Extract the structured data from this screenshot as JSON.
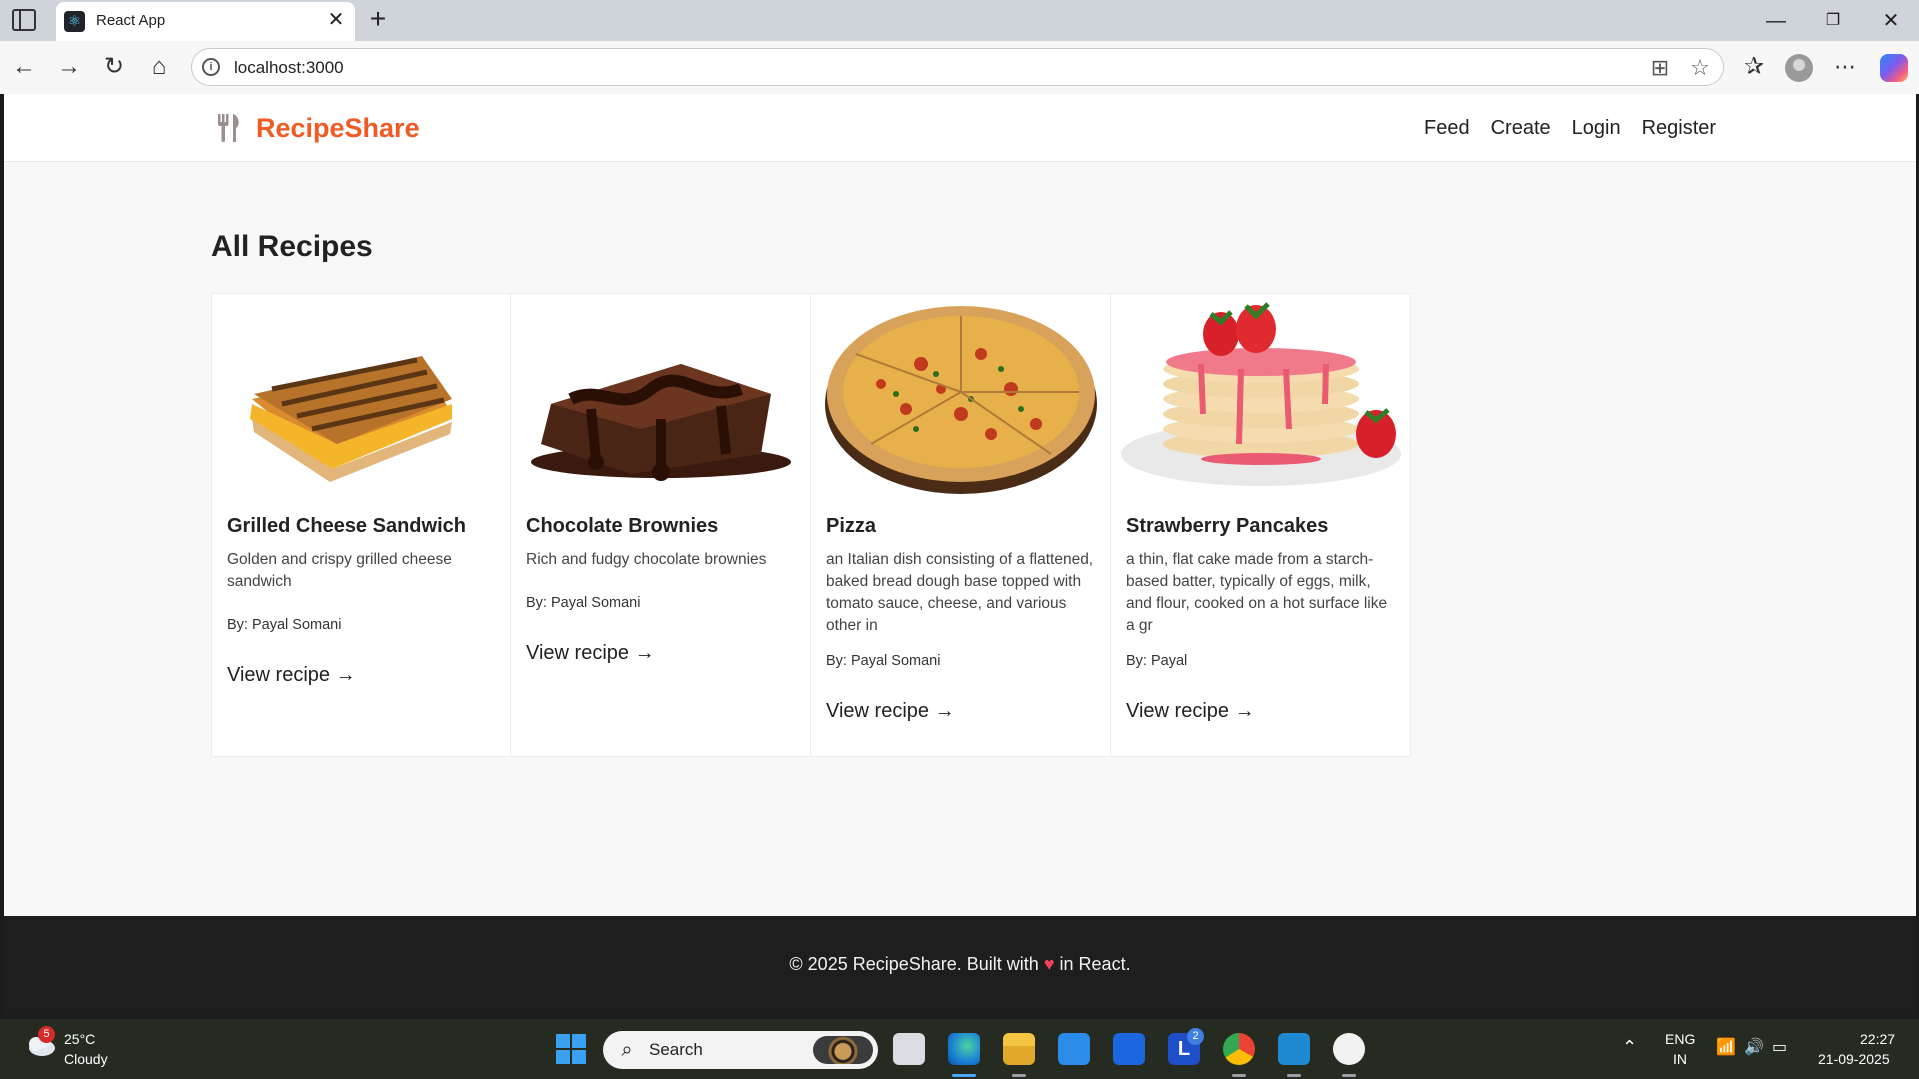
{
  "browser": {
    "tab_title": "React App",
    "url": "localhost:3000"
  },
  "site": {
    "brand": "RecipeShare",
    "nav": [
      "Feed",
      "Create",
      "Login",
      "Register"
    ],
    "page_title": "All Recipes",
    "recipes": [
      {
        "title": "Grilled Cheese Sandwich",
        "description": "Golden and crispy grilled cheese sandwich",
        "author": "By: Payal Somani",
        "link": "View recipe →"
      },
      {
        "title": "Chocolate Brownies",
        "description": "Rich and fudgy chocolate brownies",
        "author": "By: Payal Somani",
        "link": "View recipe →"
      },
      {
        "title": "Pizza",
        "description": "an Italian dish consisting of a flattened, baked bread dough base topped with tomato sauce, cheese, and various other in",
        "author": "By: Payal Somani",
        "link": "View recipe →"
      },
      {
        "title": "Strawberry Pancakes",
        "description": "a thin, flat cake made from a starch-based batter, typically of eggs, milk, and flour, cooked on a hot surface like a gr",
        "author": "By: Payal",
        "link": "View recipe →"
      }
    ],
    "footer": {
      "before": "© 2025 RecipeShare. Built with",
      "after": "in React."
    }
  },
  "taskbar": {
    "weather_badge": "5",
    "temperature": "25°C",
    "condition": "Cloudy",
    "search_placeholder": "Search",
    "teams_badge": "2",
    "language_top": "ENG",
    "language_bottom": "IN",
    "time": "22:27",
    "date": "21-09-2025"
  },
  "colors": {
    "brand": "#f05a24",
    "footer_bg": "#1e1e1e",
    "page_bg": "#f8f8f8"
  }
}
